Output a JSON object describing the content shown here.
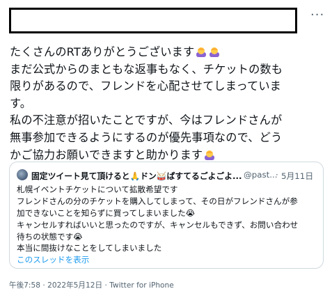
{
  "header": {
    "more_icon": "more-dots-icon",
    "more_glyph": "···"
  },
  "tweet": {
    "lines": [
      "たくさんのRTありがとうございます",
      "まだ公式からのまともな返事もなく、チケットの数も",
      "限りがあるので、フレンドを心配させてしまっていま",
      "す。",
      "私の不注意が招いたことですが、今はフレンドさんが",
      "無事参加できるようにするのが優先事項なので、どう",
      "かご協力お願いできますと助かります"
    ],
    "emoji_line1": [
      "person-bowing-emoji",
      "person-bowing-emoji"
    ],
    "emoji_line7": [
      "person-bowing-emoji"
    ]
  },
  "quote": {
    "display_name": "固定ツイート見て頂けると🙏ドン🥁ぱすてるごよごよ...",
    "handle": "@past...",
    "separator": "·",
    "date": "5月11日",
    "lines": [
      "札幌イベントチケットについて拡散希望です",
      "フレンドさんの分のチケットを購入してしまって、その日がフレンドさんが参",
      "加できないことを知らずに買ってしまいました😭",
      "キャンセルすればいいと思ったのですが、キャンセルもできず、お問い合わせ",
      "待ちの状態です😭",
      "本当に間抜けなことをしてしまいました"
    ],
    "thread_link": "このスレッドを表示"
  },
  "meta": {
    "time": "午後7:58",
    "dot": "·",
    "date": "2022年5月12日",
    "source": "Twitter for iPhone"
  },
  "colors": {
    "text": "#0f1419",
    "secondary": "#536471",
    "link": "#1d9bf0",
    "border": "#cfd9de"
  }
}
